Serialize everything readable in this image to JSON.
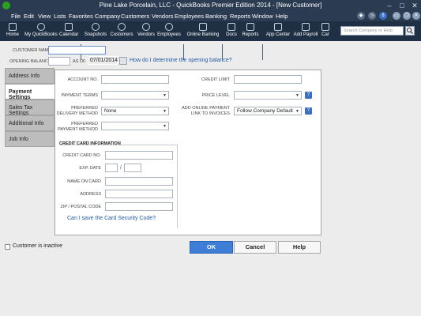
{
  "window": {
    "title": "Pine Lake Porcelain, LLC  -  QuickBooks Premier Edition 2014 - [New Customer]",
    "controls": [
      "–",
      "□",
      "✕"
    ]
  },
  "menu": {
    "items": [
      "File",
      "Edit",
      "View",
      "Lists",
      "Favorites",
      "Company",
      "Customers",
      "Vendors",
      "Employees",
      "Banking",
      "Reports",
      "Window",
      "Help"
    ],
    "badge_count": "8"
  },
  "toolbar": {
    "items": [
      "Home",
      "My QuickBooks",
      "Calendar",
      "Snapshots",
      "Customers",
      "Vendors",
      "Employees",
      "Online Banking",
      "Docs",
      "Reports",
      "App Center",
      "Add Payroll",
      "Car"
    ],
    "search_placeholder": "Search Company or Help"
  },
  "header": {
    "customer_name_label": "CUSTOMER NAME",
    "customer_name_value": "",
    "opening_balance_label": "OPENING BALANCE",
    "as_of_label": "AS OF",
    "as_of_value": "07/01/2014",
    "opening_balance_link": "How do I determine the opening balance?"
  },
  "tabs": [
    "Address Info",
    "Payment Settings",
    "Sales Tax Settings",
    "Additional Info",
    "Job Info"
  ],
  "active_tab": "Payment Settings",
  "payment": {
    "account_no_label": "ACCOUNT NO.",
    "credit_limit_label": "CREDIT LIMIT",
    "payment_terms_label": "PAYMENT TERMS",
    "price_level_label": "PRICE LEVEL",
    "preferred_delivery_label_1": "PREFERRED",
    "preferred_delivery_label_2": "DELIVERY METHOD",
    "preferred_delivery_value": "None",
    "online_payment_label_1": "ADD ONLINE PAYMENT",
    "online_payment_label_2": "LINK TO INVOICES",
    "online_payment_value": "Follow Company Default",
    "preferred_payment_label_1": "PREFERRED",
    "preferred_payment_label_2": "PAYMENT METHOD"
  },
  "credit_card": {
    "section_title": "CREDIT CARD INFORMATION",
    "card_no_label": "CREDIT CARD NO.",
    "exp_date_label": "EXP. DATE",
    "exp_sep": "/",
    "name_label": "NAME ON CARD",
    "address_label": "ADDRESS",
    "zip_label": "ZIP / POSTAL CODE",
    "security_link": "Can I save the Card Security Code?"
  },
  "footer": {
    "inactive_label": "Customer is inactive",
    "ok_label": "OK",
    "cancel_label": "Cancel",
    "help_label": "Help"
  },
  "colors": {
    "title_bar": "#2a3b52",
    "toolbar": "#1f3045",
    "primary_button": "#3f7ed6",
    "link": "#1e5aa8"
  }
}
